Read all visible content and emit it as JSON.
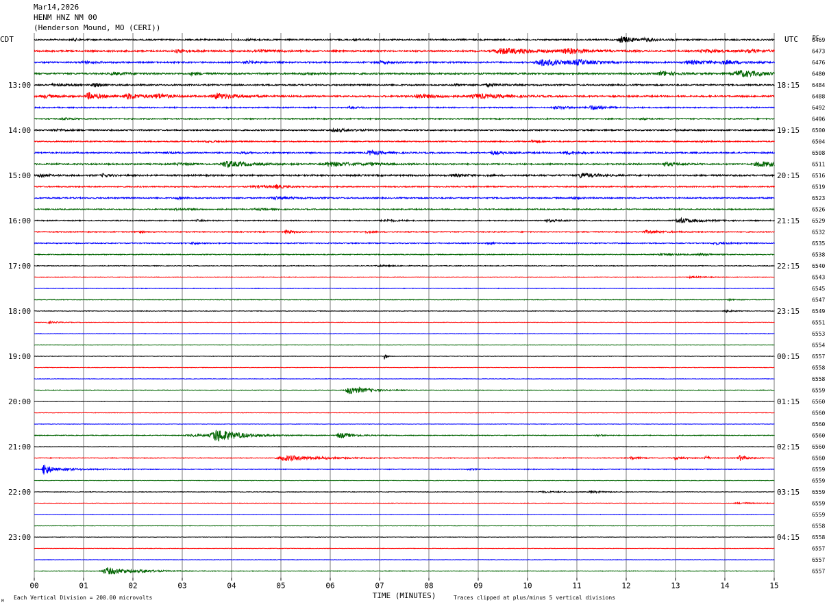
{
  "header": {
    "date": "Mar14,2026",
    "station": "HENM HNZ NM 00",
    "location": "(Henderson Mound, MO (CERI))"
  },
  "axes": {
    "left_title": "CDT",
    "right_title": "UTC",
    "dc_title": "DC",
    "x_title": "TIME (MINUTES)",
    "x_ticks": [
      "00",
      "01",
      "02",
      "03",
      "04",
      "05",
      "06",
      "07",
      "08",
      "09",
      "10",
      "11",
      "12",
      "13",
      "14",
      "15"
    ],
    "left_hours": [
      "13:00",
      "14:00",
      "15:00",
      "16:00",
      "17:00",
      "18:00",
      "19:00",
      "20:00",
      "21:00",
      "22:00",
      "23:00"
    ],
    "right_hours": [
      "18:15",
      "19:15",
      "20:15",
      "21:15",
      "22:15",
      "23:15",
      "00:15",
      "01:15",
      "02:15",
      "03:15",
      "04:15"
    ]
  },
  "footer": {
    "scale": "Each Vertical Division =  200.00 microvolts",
    "clip_note": "Traces clipped at plus/minus 5 vertical divisions",
    "corner_mark": "M"
  },
  "dc_values": [
    "6469",
    "6473",
    "6476",
    "6480",
    "6484",
    "6488",
    "6492",
    "6496",
    "6500",
    "6504",
    "6508",
    "6511",
    "6516",
    "6519",
    "6523",
    "6526",
    "6529",
    "6532",
    "6535",
    "6538",
    "6540",
    "6543",
    "6545",
    "6547",
    "6549",
    "6551",
    "6553",
    "6554",
    "6557",
    "6558",
    "6558",
    "6559",
    "6560",
    "6560",
    "6560",
    "6560",
    "6560",
    "6560",
    "6559",
    "6559",
    "6559",
    "6559",
    "6559",
    "6558",
    "6558",
    "6557",
    "6557",
    "6557"
  ],
  "trace_colors": [
    "#000000",
    "#ff0000",
    "#0000ff",
    "#006400"
  ],
  "trace_activity": [
    {
      "base": 1.0,
      "bursts": [
        [
          0.8,
          0.12,
          1.2
        ],
        [
          4.3,
          0.1,
          1.3
        ],
        [
          6.5,
          0.1,
          1.0
        ],
        [
          11.9,
          0.2,
          4.5
        ],
        [
          12.4,
          0.2,
          1.6
        ]
      ]
    },
    {
      "base": 1.1,
      "bursts": [
        [
          2.9,
          0.2,
          2.0
        ],
        [
          4.5,
          0.3,
          1.5
        ],
        [
          9.5,
          0.5,
          4.0
        ],
        [
          10.8,
          0.3,
          3.5
        ],
        [
          13.6,
          0.3,
          1.8
        ],
        [
          14.5,
          0.3,
          1.5
        ]
      ]
    },
    {
      "base": 1.0,
      "bursts": [
        [
          1.0,
          0.2,
          1.3
        ],
        [
          4.3,
          0.2,
          1.6
        ],
        [
          7.0,
          0.2,
          1.5
        ],
        [
          10.3,
          0.4,
          5.0
        ],
        [
          11.0,
          0.2,
          3.0
        ],
        [
          13.3,
          0.4,
          2.5
        ],
        [
          14.0,
          0.3,
          1.8
        ]
      ]
    },
    {
      "base": 1.1,
      "bursts": [
        [
          1.6,
          0.3,
          1.5
        ],
        [
          3.2,
          0.1,
          2.5
        ],
        [
          5.5,
          0.3,
          1.0
        ],
        [
          12.7,
          0.2,
          3.5
        ],
        [
          14.3,
          0.4,
          4.5
        ]
      ]
    },
    {
      "base": 1.0,
      "bursts": [
        [
          0.4,
          0.2,
          1.5
        ],
        [
          1.2,
          0.1,
          3.5
        ],
        [
          8.5,
          0.1,
          1.5
        ],
        [
          9.2,
          0.2,
          1.8
        ]
      ]
    },
    {
      "base": 1.1,
      "bursts": [
        [
          0.2,
          0.2,
          2.0
        ],
        [
          1.1,
          0.2,
          4.5
        ],
        [
          1.9,
          0.3,
          3.5
        ],
        [
          2.5,
          0.2,
          3.0
        ],
        [
          3.7,
          0.3,
          4.0
        ],
        [
          7.8,
          0.3,
          3.0
        ],
        [
          9.0,
          0.4,
          3.0
        ]
      ]
    },
    {
      "base": 0.8,
      "bursts": [
        [
          6.4,
          0.1,
          1.2
        ],
        [
          10.6,
          0.3,
          1.5
        ],
        [
          11.3,
          0.2,
          3.0
        ]
      ]
    },
    {
      "base": 0.8,
      "bursts": [
        [
          0.6,
          0.2,
          1.0
        ],
        [
          12.3,
          0.1,
          1.0
        ]
      ]
    },
    {
      "base": 0.9,
      "bursts": [
        [
          0.4,
          0.2,
          1.5
        ],
        [
          6.1,
          0.3,
          2.0
        ],
        [
          13.0,
          0.1,
          1.0
        ]
      ]
    },
    {
      "base": 0.8,
      "bursts": [
        [
          3.5,
          0.2,
          1.0
        ],
        [
          10.1,
          0.1,
          1.8
        ],
        [
          13.5,
          0.1,
          1.0
        ]
      ]
    },
    {
      "base": 1.0,
      "bursts": [
        [
          2.7,
          0.1,
          1.2
        ],
        [
          4.2,
          0.1,
          1.5
        ],
        [
          6.8,
          0.2,
          3.0
        ],
        [
          9.3,
          0.2,
          2.0
        ],
        [
          10.8,
          0.2,
          2.0
        ]
      ]
    },
    {
      "base": 1.0,
      "bursts": [
        [
          2.9,
          0.2,
          1.5
        ],
        [
          3.9,
          0.3,
          4.5
        ],
        [
          6.0,
          0.4,
          3.0
        ],
        [
          6.8,
          0.1,
          1.5
        ],
        [
          12.8,
          0.2,
          2.5
        ],
        [
          14.7,
          0.3,
          4.0
        ]
      ]
    },
    {
      "base": 1.1,
      "bursts": [
        [
          0.1,
          0.1,
          3.0
        ],
        [
          1.4,
          0.1,
          2.0
        ],
        [
          8.5,
          0.2,
          1.5
        ],
        [
          11.1,
          0.2,
          3.5
        ]
      ]
    },
    {
      "base": 0.8,
      "bursts": [
        [
          4.9,
          0.1,
          2.5
        ],
        [
          4.5,
          0.4,
          1.2
        ]
      ]
    },
    {
      "base": 0.9,
      "bursts": [
        [
          2.9,
          0.1,
          1.5
        ],
        [
          4.9,
          0.3,
          1.8
        ],
        [
          10.9,
          0.1,
          1.5
        ]
      ]
    },
    {
      "base": 0.8,
      "bursts": [
        [
          2.9,
          0.3,
          1.0
        ],
        [
          4.5,
          0.2,
          1.0
        ]
      ]
    },
    {
      "base": 0.7,
      "bursts": [
        [
          3.3,
          0.1,
          1.0
        ],
        [
          7.1,
          0.2,
          1.4
        ],
        [
          10.4,
          0.2,
          1.7
        ],
        [
          13.1,
          0.3,
          3.5
        ]
      ]
    },
    {
      "base": 0.7,
      "bursts": [
        [
          2.1,
          0.1,
          1.5
        ],
        [
          5.1,
          0.1,
          3.0
        ],
        [
          6.7,
          0.1,
          1.3
        ],
        [
          12.4,
          0.3,
          1.8
        ]
      ]
    },
    {
      "base": 0.7,
      "bursts": [
        [
          3.2,
          0.1,
          1.5
        ],
        [
          9.2,
          0.1,
          1.3
        ],
        [
          13.8,
          0.2,
          1.5
        ]
      ]
    },
    {
      "base": 0.6,
      "bursts": [
        [
          12.7,
          0.3,
          1.2
        ],
        [
          13.5,
          0.2,
          1.2
        ]
      ]
    },
    {
      "base": 0.5,
      "bursts": [
        [
          7.0,
          0.2,
          1.0
        ]
      ]
    },
    {
      "base": 0.4,
      "bursts": [
        [
          13.3,
          0.2,
          1.2
        ]
      ]
    },
    {
      "base": 0.4,
      "bursts": []
    },
    {
      "base": 0.4,
      "bursts": [
        [
          14.1,
          0.1,
          1.2
        ]
      ]
    },
    {
      "base": 0.4,
      "bursts": [
        [
          14.0,
          0.1,
          1.8
        ]
      ]
    },
    {
      "base": 0.3,
      "bursts": [
        [
          0.3,
          0.2,
          1.2
        ]
      ]
    },
    {
      "base": 0.3,
      "bursts": []
    },
    {
      "base": 0.3,
      "bursts": []
    },
    {
      "base": 0.3,
      "bursts": [
        [
          7.1,
          0.03,
          5.0
        ]
      ]
    },
    {
      "base": 0.3,
      "bursts": []
    },
    {
      "base": 0.3,
      "bursts": []
    },
    {
      "base": 0.4,
      "bursts": [
        [
          6.4,
          0.25,
          6.0
        ]
      ]
    },
    {
      "base": 0.3,
      "bursts": []
    },
    {
      "base": 0.3,
      "bursts": []
    },
    {
      "base": 0.3,
      "bursts": []
    },
    {
      "base": 0.5,
      "bursts": [
        [
          3.2,
          0.4,
          1.5
        ],
        [
          3.7,
          0.35,
          9.0
        ],
        [
          6.2,
          0.2,
          4.0
        ],
        [
          11.4,
          0.1,
          1.5
        ]
      ]
    },
    {
      "base": 0.3,
      "bursts": []
    },
    {
      "base": 0.5,
      "bursts": [
        [
          5.1,
          0.5,
          4.0
        ],
        [
          12.1,
          0.1,
          2.5
        ],
        [
          14.3,
          0.1,
          4.0
        ],
        [
          13.6,
          0.05,
          3.5
        ],
        [
          13.0,
          0.2,
          1.5
        ]
      ]
    },
    {
      "base": 0.5,
      "bursts": [
        [
          0.2,
          0.1,
          10.0
        ],
        [
          0.7,
          0.4,
          1.2
        ],
        [
          8.8,
          0.1,
          1.0
        ]
      ]
    },
    {
      "base": 0.3,
      "bursts": []
    },
    {
      "base": 0.4,
      "bursts": [
        [
          10.3,
          0.3,
          1.0
        ],
        [
          11.3,
          0.2,
          1.3
        ]
      ]
    },
    {
      "base": 0.3,
      "bursts": [
        [
          14.3,
          0.3,
          1.0
        ]
      ]
    },
    {
      "base": 0.3,
      "bursts": []
    },
    {
      "base": 0.3,
      "bursts": []
    },
    {
      "base": 0.3,
      "bursts": []
    },
    {
      "base": 0.3,
      "bursts": []
    },
    {
      "base": 0.3,
      "bursts": []
    },
    {
      "base": 0.4,
      "bursts": [
        [
          1.5,
          0.35,
          5.0
        ],
        [
          2.2,
          0.2,
          1.2
        ]
      ]
    }
  ]
}
